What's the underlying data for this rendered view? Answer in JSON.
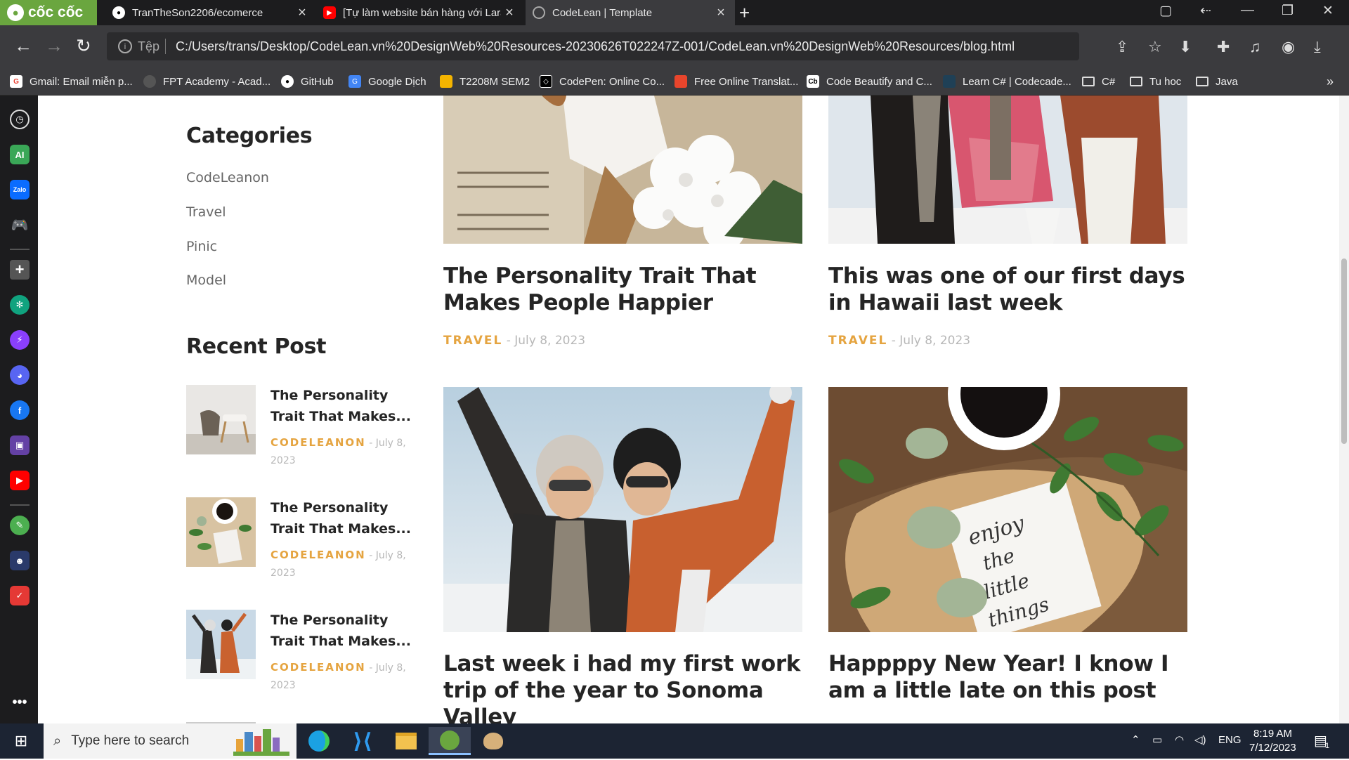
{
  "browser": {
    "brand": "cốc cốc",
    "tabs": [
      {
        "title": "TranTheSon2206/ecomerce",
        "icon": "github-icon"
      },
      {
        "title": "[Tự làm website bán hàng với Lara",
        "icon": "youtube-icon"
      },
      {
        "title": "CodeLean | Template",
        "icon": "globe-icon"
      }
    ],
    "address": {
      "scheme_label": "Tệp",
      "url": "C:/Users/trans/Desktop/CodeLean.vn%20DesignWeb%20Resources-20230626T022247Z-001/CodeLean.vn%20DesignWeb%20Resources/blog.html"
    },
    "bookmarks": [
      {
        "label": "Gmail: Email miễn p...",
        "icon": "google-icon",
        "color": "#ffffff"
      },
      {
        "label": "FPT Academy - Acad...",
        "icon": "globe-icon",
        "color": "#555555"
      },
      {
        "label": "GitHub",
        "icon": "github-icon",
        "color": "#ffffff"
      },
      {
        "label": "Google Dịch",
        "icon": "google-translate-icon",
        "color": "#4285f4"
      },
      {
        "label": "T2208M SEM2",
        "icon": "classroom-icon",
        "color": "#f4b400"
      },
      {
        "label": "CodePen: Online Co...",
        "icon": "codepen-icon",
        "color": "#000000"
      },
      {
        "label": "Free Online Translat...",
        "icon": "translate-icon",
        "color": "#e8452c"
      },
      {
        "label": "Code Beautify and C...",
        "icon": "codebeautify-icon",
        "color": "#ffffff"
      },
      {
        "label": "Learn C# | Codecade...",
        "icon": "codecademy-icon",
        "color": "#1f4056"
      },
      {
        "label": "C#",
        "icon": "folder-icon"
      },
      {
        "label": "Tu hoc",
        "icon": "folder-icon"
      },
      {
        "label": "Java",
        "icon": "folder-icon"
      }
    ]
  },
  "sidebar": {
    "categories_heading": "Categories",
    "categories": [
      "CodeLeanon",
      "Travel",
      "Pinic",
      "Model"
    ],
    "recent_heading": "Recent Post",
    "recent_posts": [
      {
        "title": "The Personality Trait That Makes...",
        "tag": "CODELEANON",
        "date": "- July 8, 2023"
      },
      {
        "title": "The Personality Trait That Makes...",
        "tag": "CODELEANON",
        "date": "- July 8, 2023"
      },
      {
        "title": "The Personality Trait That Makes...",
        "tag": "CODELEANON",
        "date": "- July 8, 2023"
      }
    ]
  },
  "posts": [
    {
      "title": "The Personality Trait That Makes People Happier",
      "tag": "TRAVEL",
      "date": "- July 8, 2023"
    },
    {
      "title": "This was one of our first days in Hawaii last week",
      "tag": "TRAVEL",
      "date": "- July 8, 2023"
    },
    {
      "title": "Last week i had my first work trip of the year to Sonoma Valley",
      "tag": "",
      "date": ""
    },
    {
      "title": "Happppy New Year! I know I am a little late on this post",
      "tag": "",
      "date": ""
    }
  ],
  "note_card_text": "enjoy the little things",
  "taskbar": {
    "search_placeholder": "Type here to search",
    "language": "ENG",
    "time": "8:19 AM",
    "date": "7/12/2023",
    "notification_count": "1"
  },
  "colors": {
    "accent_tag": "#e5a440",
    "brand_green": "#6aa63f",
    "chrome_dark": "#3b3b3e"
  }
}
